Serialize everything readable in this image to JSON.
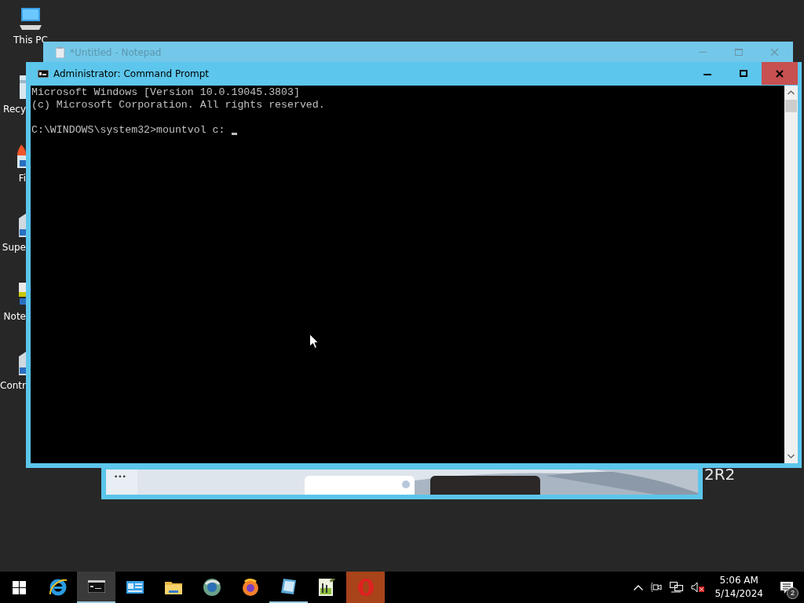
{
  "desktop_icons": [
    {
      "label": "This PC",
      "kind": "computer"
    },
    {
      "label": "Recy",
      "kind": "bin"
    },
    {
      "label": "Fi",
      "kind": "flame"
    },
    {
      "label": "Supe",
      "kind": "shortcut"
    },
    {
      "label": "Note",
      "kind": "note"
    },
    {
      "label": "Contr",
      "kind": "shortcut"
    }
  ],
  "wallpaper_text": "2R2",
  "background_window": {
    "menu_button": "•••"
  },
  "notepad": {
    "title": "*Untitled - Notepad"
  },
  "command_prompt": {
    "title": "Administrator: Command Prompt",
    "output": [
      "Microsoft Windows [Version 10.0.19045.3803]",
      "(c) Microsoft Corporation. All rights reserved."
    ],
    "prompt": "C:\\WINDOWS\\system32>",
    "command": "mountvol c:",
    "cursor": true
  },
  "taskbar": {
    "items": [
      {
        "kind": "start",
        "active": false,
        "running": false,
        "highlighted": false
      },
      {
        "kind": "ie",
        "active": false,
        "running": false,
        "highlighted": false
      },
      {
        "kind": "console",
        "active": true,
        "running": true,
        "highlighted": false
      },
      {
        "kind": "panel",
        "active": false,
        "running": false,
        "highlighted": false
      },
      {
        "kind": "folder",
        "active": false,
        "running": false,
        "highlighted": false
      },
      {
        "kind": "globe",
        "active": false,
        "running": false,
        "highlighted": false
      },
      {
        "kind": "firefox",
        "active": false,
        "running": false,
        "highlighted": false
      },
      {
        "kind": "tablet",
        "active": false,
        "running": true,
        "highlighted": false
      },
      {
        "kind": "chart",
        "active": false,
        "running": false,
        "highlighted": false
      },
      {
        "kind": "opera",
        "active": false,
        "running": false,
        "highlighted": true
      }
    ],
    "clock": {
      "time": "5:06 AM",
      "date": "5/14/2024"
    },
    "volume_muted": true,
    "notifications": "2"
  }
}
